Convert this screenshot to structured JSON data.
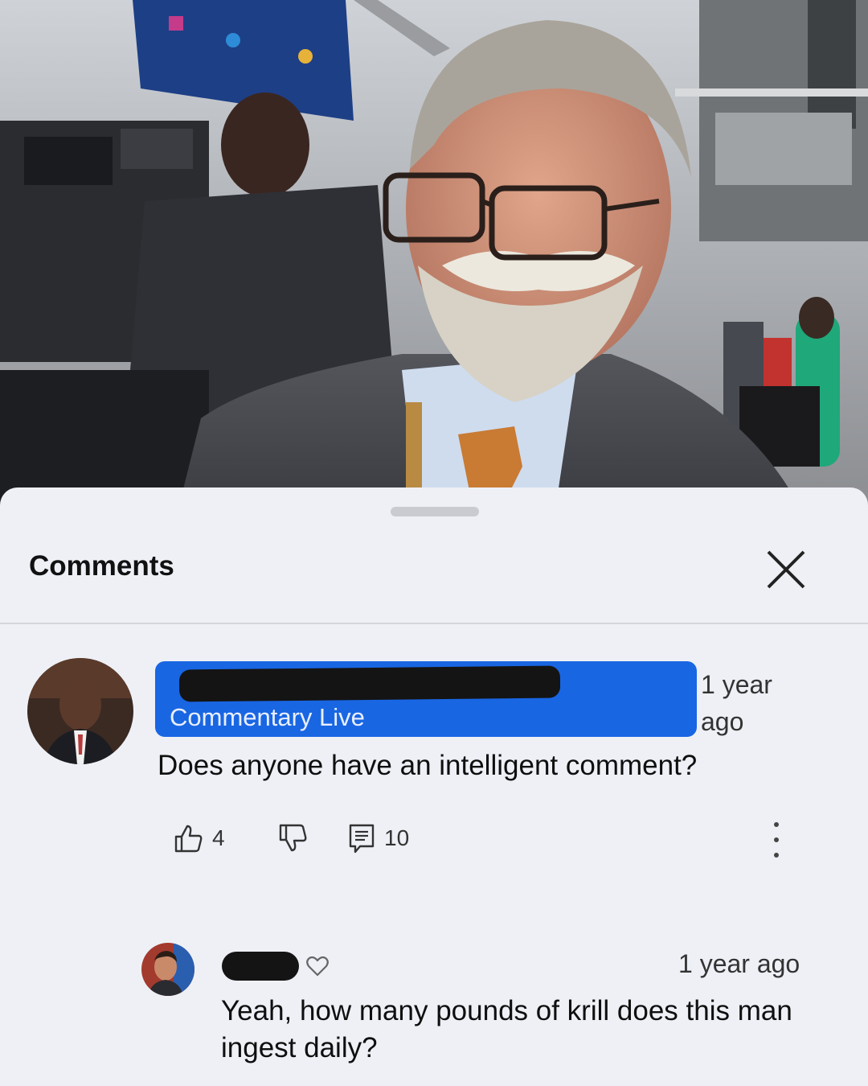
{
  "comments_panel": {
    "title": "Comments",
    "close_icon": "close-icon"
  },
  "top_comment": {
    "author_redacted": true,
    "channel_label": "Commentary Live",
    "timestamp": "1 year ago",
    "text": "Does anyone have an intelligent comment?",
    "like_count": "4",
    "reply_count": "10",
    "icons": [
      "thumbs-up-icon",
      "thumbs-down-icon",
      "reply-icon",
      "more-vert-icon"
    ],
    "highlight_color": "#1966e3"
  },
  "reply": {
    "author_redacted": true,
    "timestamp": "1 year ago",
    "text": "Yeah, how many pounds of krill does this man ingest daily?",
    "icons": [
      "heart-icon"
    ]
  }
}
